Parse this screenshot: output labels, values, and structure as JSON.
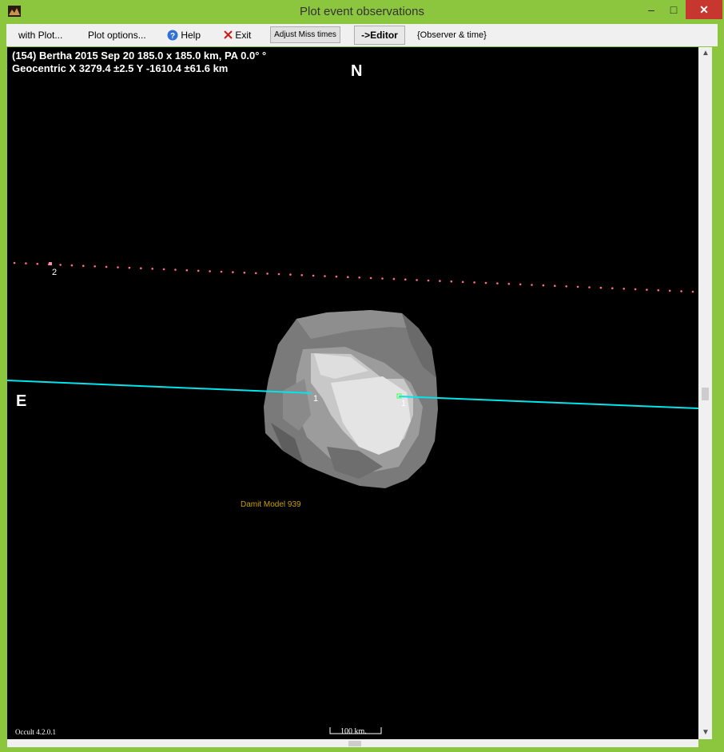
{
  "window": {
    "title": "Plot event observations",
    "controls": {
      "minimize": "–",
      "maximize": "□",
      "close": "✕"
    }
  },
  "menu": {
    "with_plot": "with Plot...",
    "plot_options": "Plot options...",
    "help": "Help",
    "exit": "Exit",
    "adjust_miss_times": "Adjust Miss times",
    "editor": "->Editor",
    "observer_time": "{Observer & time}"
  },
  "plot": {
    "header_line1": "(154) Bertha  2015 Sep 20  185.0 x 185.0 km, PA 0.0° °",
    "header_line2": "Geocentric  X  3279.4 ±2.5  Y -1610.4 ±61.6 km",
    "north_label": "N",
    "east_label": "E",
    "model_label": "Damit Model 939",
    "chord_label_1": "1",
    "chord_label_1b": "1",
    "miss_label_2": "2",
    "version": "Occult 4.2.0.1",
    "scale_label": "100 km.",
    "colors": {
      "background": "#000000",
      "chord": "#00e5ee",
      "miss_dots": "#ff6b8a",
      "model_label": "#c8a000",
      "text": "#ffffff",
      "frame": "#8cc63f"
    }
  }
}
